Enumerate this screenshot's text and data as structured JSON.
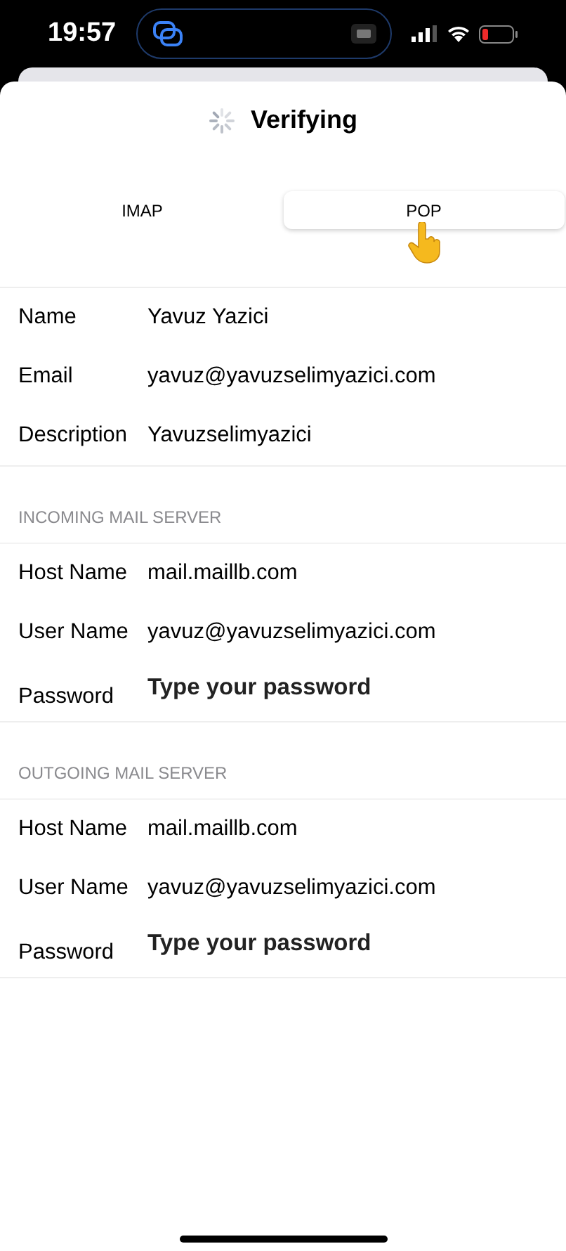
{
  "status_bar": {
    "time": "19:57"
  },
  "title": "Verifying",
  "tabs": [
    {
      "label": "IMAP",
      "selected": false
    },
    {
      "label": "POP",
      "selected": true
    }
  ],
  "sections": [
    {
      "fields": [
        {
          "label": "Name",
          "value": "Yavuz Yazici",
          "kind": "text"
        },
        {
          "label": "Email",
          "value": "yavuz@yavuzselimyazici.com",
          "kind": "text"
        },
        {
          "label": "Description",
          "value": "Yavuzselimyazici",
          "kind": "text"
        }
      ]
    },
    {
      "header": "INCOMING MAIL SERVER",
      "fields": [
        {
          "label": "Host Name",
          "value": "mail.maillb.com",
          "kind": "text"
        },
        {
          "label": "User Name",
          "value": "yavuz@yavuzselimyazici.com",
          "kind": "text"
        },
        {
          "label": "Password",
          "value": "Type your password",
          "kind": "password"
        }
      ]
    },
    {
      "header": "OUTGOING MAIL SERVER",
      "fields": [
        {
          "label": "Host Name",
          "value": "mail.maillb.com",
          "kind": "text"
        },
        {
          "label": "User Name",
          "value": "yavuz@yavuzselimyazici.com",
          "kind": "text"
        },
        {
          "label": "Password",
          "value": "Type your password",
          "kind": "password"
        }
      ]
    }
  ]
}
